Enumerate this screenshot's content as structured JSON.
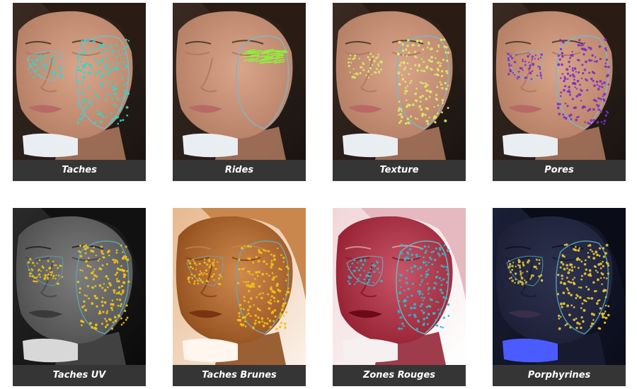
{
  "panels": [
    {
      "label": "Taches",
      "style": "natural",
      "dot": "#38d4c8"
    },
    {
      "label": "Rides",
      "style": "natural",
      "dot": "#8ff03a"
    },
    {
      "label": "Texture",
      "style": "natural",
      "dot": "#d8ea6a"
    },
    {
      "label": "Pores",
      "style": "natural",
      "dot": "#7a2fc8"
    },
    {
      "label": "Taches UV",
      "style": "uv",
      "dot": "#f0c21c"
    },
    {
      "label": "Taches Brunes",
      "style": "brown",
      "dot": "#f2c01a"
    },
    {
      "label": "Zones Rouges",
      "style": "red",
      "dot": "#2fb8c8"
    },
    {
      "label": "Porphyrines",
      "style": "dark",
      "dot": "#e8c83a"
    }
  ]
}
